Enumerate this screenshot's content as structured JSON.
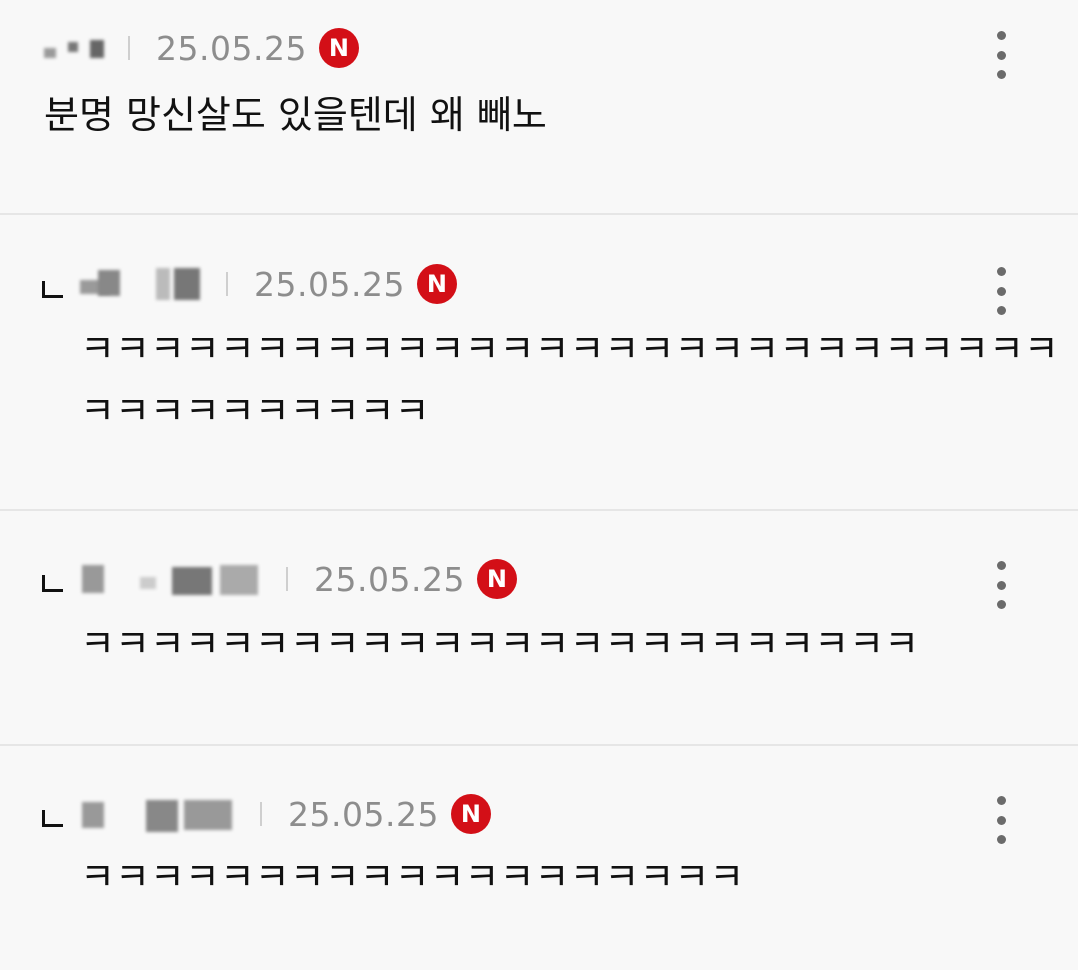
{
  "comments": [
    {
      "date": "25.05.25",
      "badge": "N",
      "is_reply": false,
      "text": "분명 망신살도 있을텐데 왜 빼노"
    },
    {
      "date": "25.05.25",
      "badge": "N",
      "is_reply": true,
      "text": "ㅋㅋㅋㅋㅋㅋㅋㅋㅋㅋㅋㅋㅋㅋㅋㅋㅋㅋㅋㅋㅋㅋㅋㅋㅋㅋㅋㅋㅋㅋㅋㅋㅋㅋㅋㅋㅋㅋ"
    },
    {
      "date": "25.05.25",
      "badge": "N",
      "is_reply": true,
      "text": "ㅋㅋㅋㅋㅋㅋㅋㅋㅋㅋㅋㅋㅋㅋㅋㅋㅋㅋㅋㅋㅋㅋㅋㅋ"
    },
    {
      "date": "25.05.25",
      "badge": "N",
      "is_reply": true,
      "text": "ㅋㅋㅋㅋㅋㅋㅋㅋㅋㅋㅋㅋㅋㅋㅋㅋㅋㅋㅋ"
    }
  ],
  "icons": {
    "reply": "reply-arrow-icon",
    "more": "more-vertical-icon",
    "new_badge": "new-badge-icon"
  },
  "colors": {
    "background": "#f8f8f8",
    "badge": "#d30f17",
    "date": "#8d8d8d",
    "divider": "#e6e6e6"
  }
}
